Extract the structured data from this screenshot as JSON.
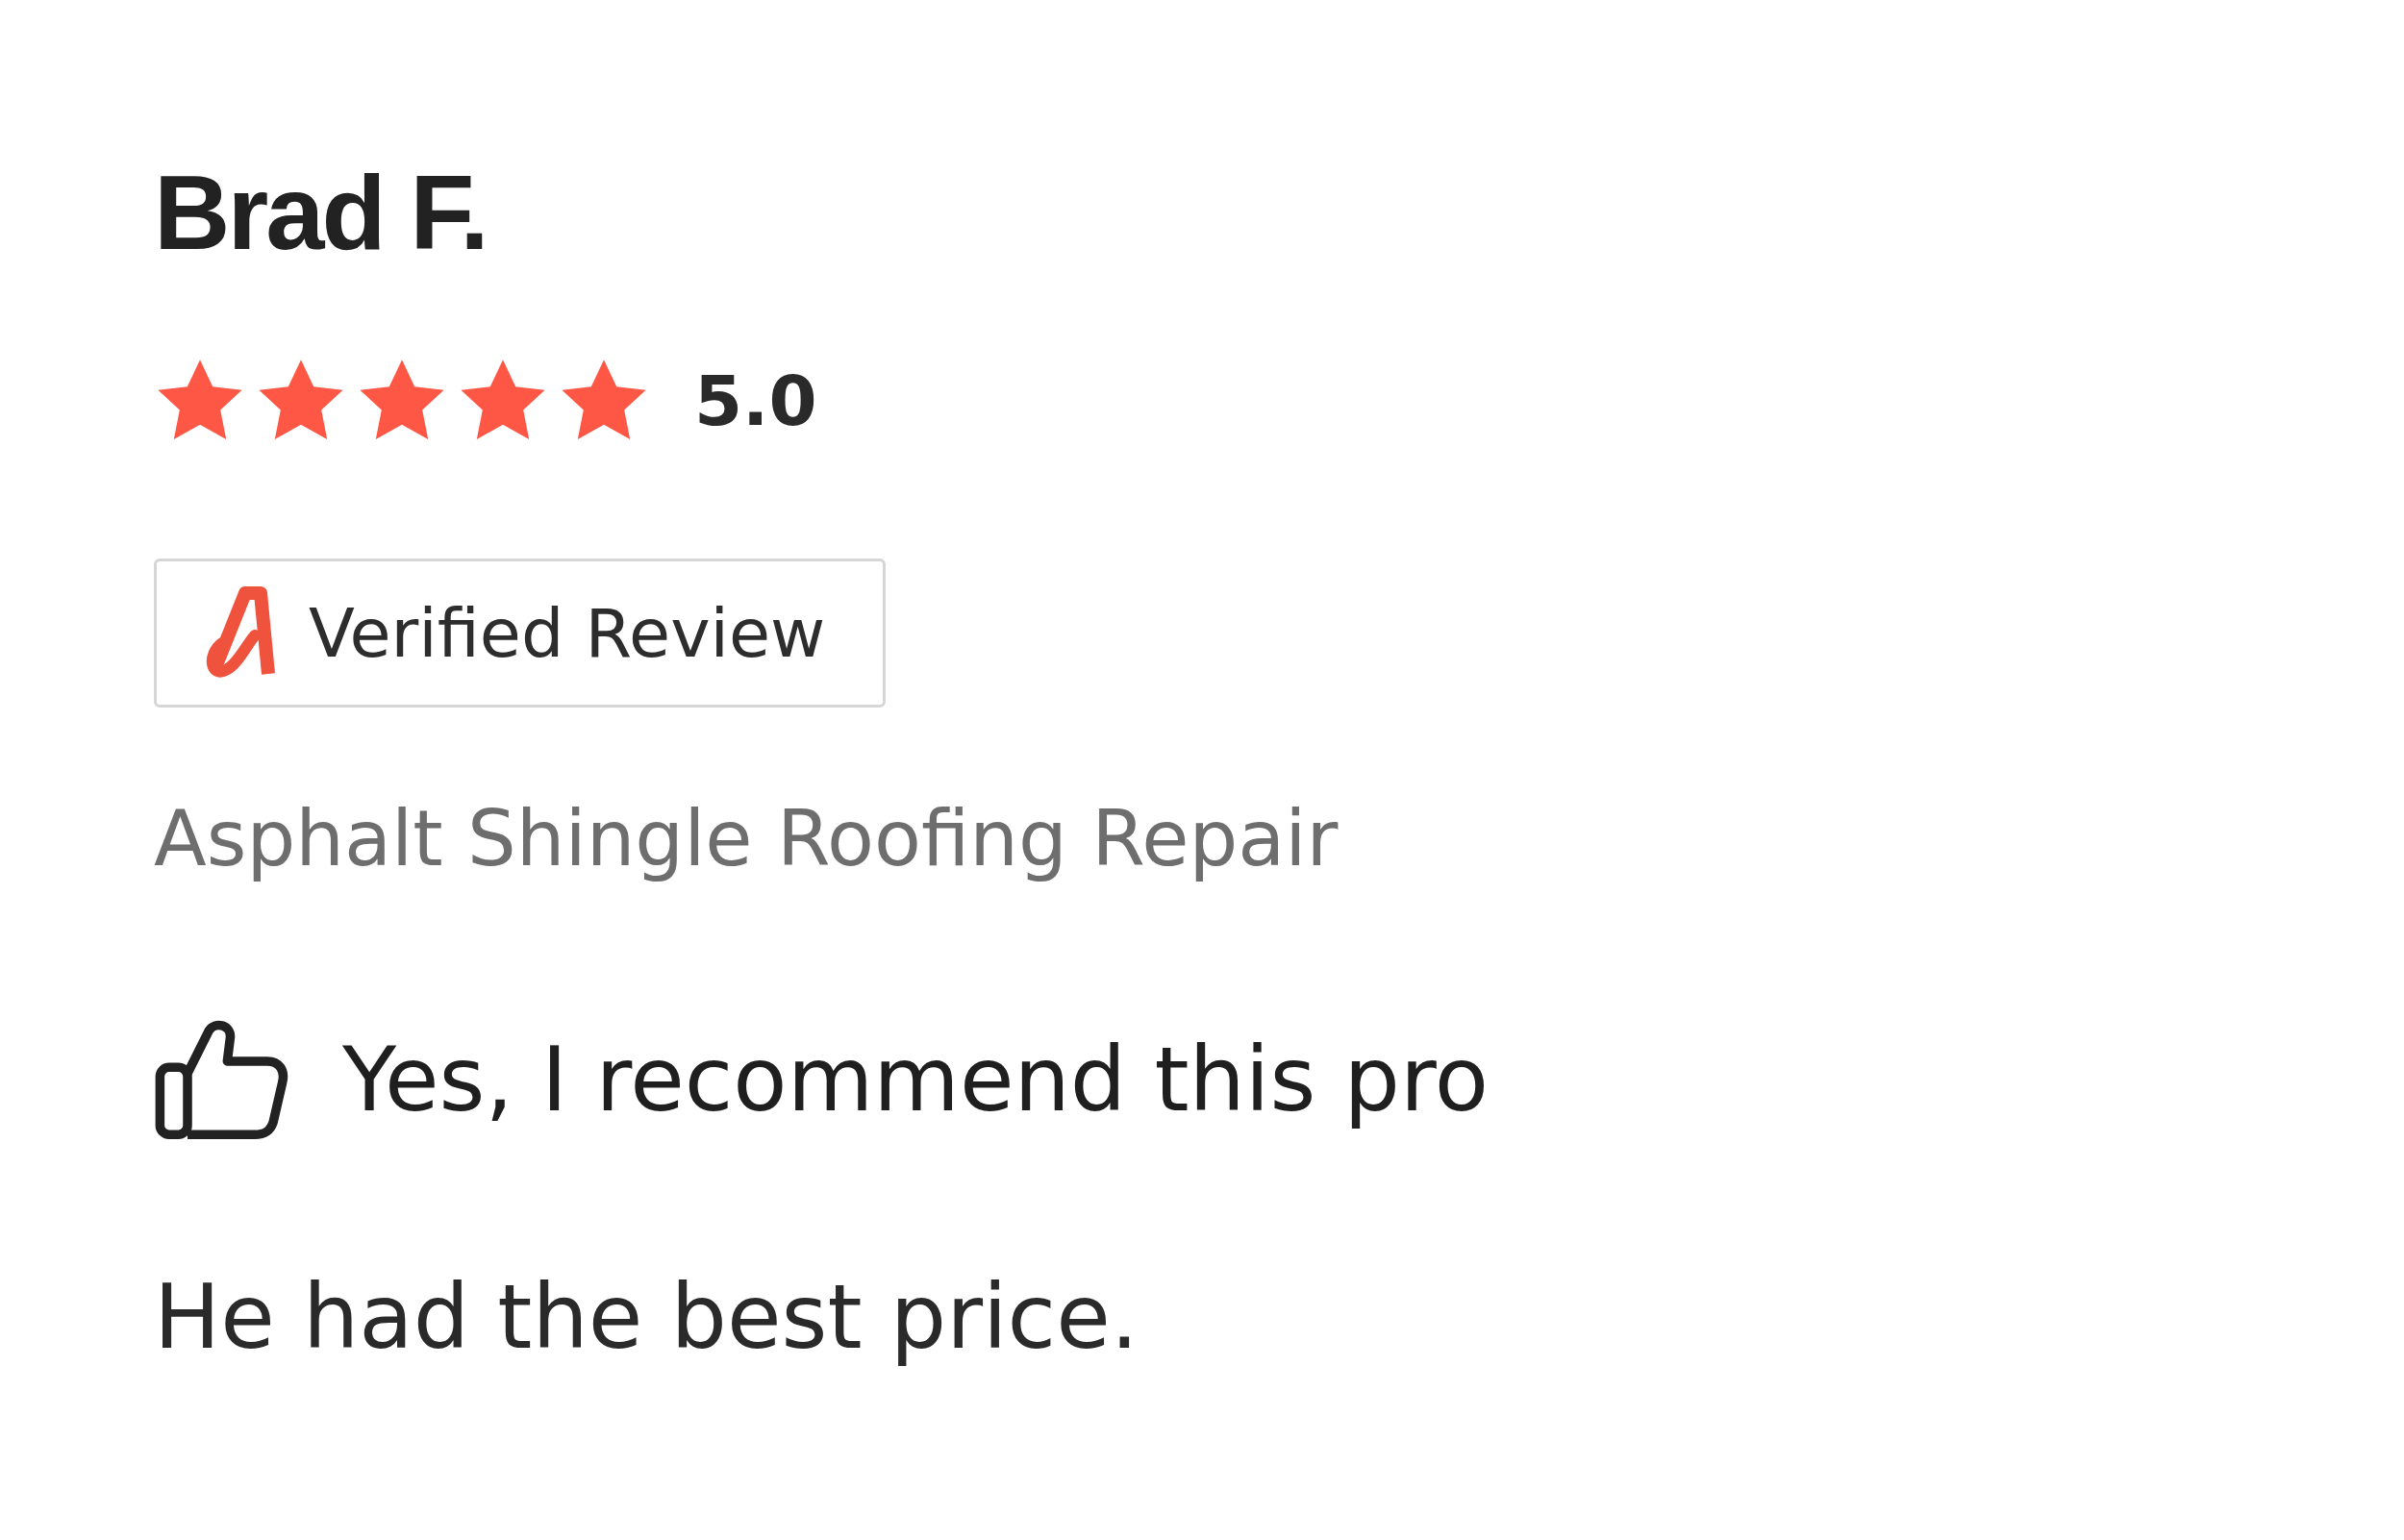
{
  "review": {
    "author": "Brad F.",
    "stars": 5,
    "rating": "5.0",
    "badge": "Verified Review",
    "service": "Asphalt Shingle Roofing Repair",
    "recommend": "Yes, I recommend this pro",
    "text": "He had the best price."
  }
}
